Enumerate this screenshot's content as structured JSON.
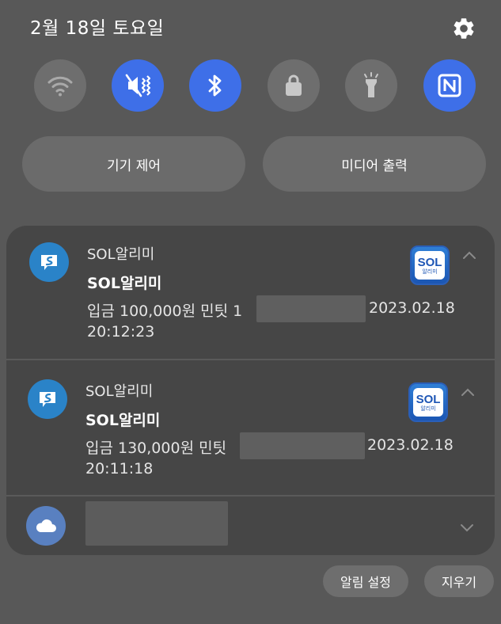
{
  "status": {
    "date": "2월 18일 토요일"
  },
  "quick_settings": [
    {
      "name": "wifi",
      "state": "off"
    },
    {
      "name": "mute",
      "state": "on"
    },
    {
      "name": "bluetooth",
      "state": "on"
    },
    {
      "name": "screen-lock",
      "state": "off"
    },
    {
      "name": "flashlight",
      "state": "off"
    },
    {
      "name": "nfc",
      "state": "on"
    }
  ],
  "pills": {
    "device_control": "기기 제어",
    "media_output": "미디어 출력"
  },
  "notifications": [
    {
      "app": "SOL알리미",
      "title": "SOL알리미",
      "body": "입금 100,000원 민팃 1",
      "date": "2023.02.18",
      "time": "20:12:23",
      "logo_main": "SOL",
      "logo_sub": "알리미"
    },
    {
      "app": "SOL알리미",
      "title": "SOL알리미",
      "body": "입금 130,000원 민팃",
      "date": "2023.02.18",
      "time": "20:11:18",
      "logo_main": "SOL",
      "logo_sub": "알리미"
    }
  ],
  "third_notification": {
    "app": "cloud"
  },
  "footer": {
    "notif_settings": "알림 설정",
    "clear": "지우기"
  },
  "colors": {
    "accent_on": "#3e6fe8",
    "tile_off": "#6e6e6e",
    "background": "#585858",
    "card": "#464646"
  }
}
